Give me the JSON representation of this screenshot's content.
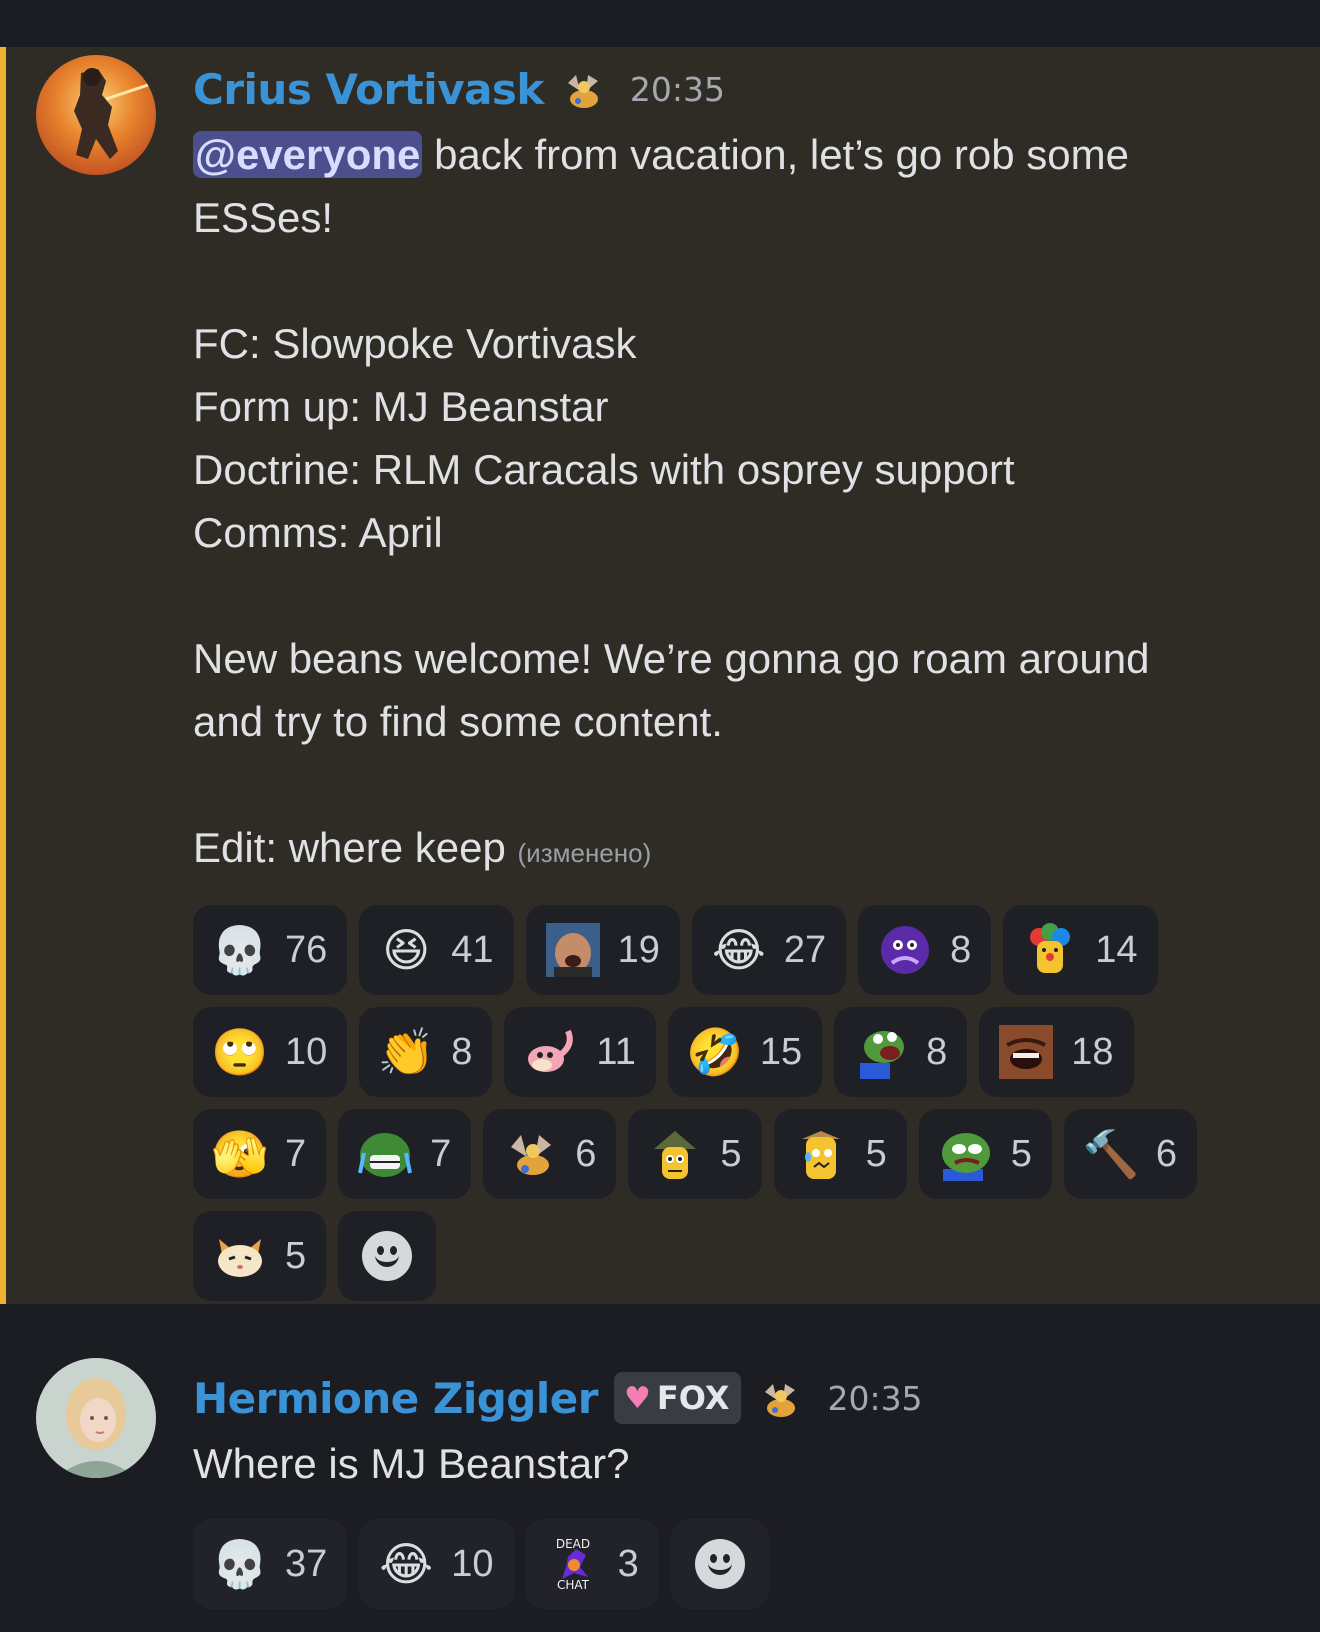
{
  "colors": {
    "author": "#3a93d6",
    "highlight_bg": "#2f2c26",
    "highlight_border": "#f0b232",
    "mention_bg": "#4c4f8e",
    "background": "#1c1d22"
  },
  "messages": [
    {
      "author": "Crius Vortivask",
      "role_icon": "winged-figure-icon",
      "timestamp": "20:35",
      "mention": "@everyone",
      "lines": [
        " back from vacation, let’s go rob some\nESSes!\n\nFC: Slowpoke Vortivask\nForm up: MJ Beanstar\nDoctrine: RLM Caracals with osprey support\nComms: April\n\nNew beans welcome! We’re gonna go roam around\nand try to find some content.\n\nEdit: where keep "
      ],
      "edited": "(изменено)",
      "reactions": [
        {
          "icon": "skull-emoji",
          "glyph": "💀",
          "count": "76"
        },
        {
          "icon": "laughing-squint-emoji",
          "glyph": "😆",
          "count": "41"
        },
        {
          "icon": "laughing-man-custom-emoji",
          "glyph": "",
          "count": "19"
        },
        {
          "icon": "tears-of-joy-emoji",
          "glyph": "😂",
          "count": "27"
        },
        {
          "icon": "purple-galaxy-custom-emoji",
          "glyph": "",
          "count": "8"
        },
        {
          "icon": "clown-bean-custom-emoji",
          "glyph": "",
          "count": "14"
        },
        {
          "icon": "eye-roll-emoji",
          "glyph": "🙄",
          "count": "10"
        },
        {
          "icon": "clapping-hands-emoji",
          "glyph": "👏",
          "count": "8"
        },
        {
          "icon": "slowpoke-custom-emoji",
          "glyph": "",
          "count": "11"
        },
        {
          "icon": "rofl-emoji",
          "glyph": "🤣",
          "count": "15"
        },
        {
          "icon": "pepe-shout-custom-emoji",
          "glyph": "",
          "count": "8"
        },
        {
          "icon": "laughing-face-custom-emoji",
          "glyph": "",
          "count": "18"
        },
        {
          "icon": "face-covering-hands-emoji",
          "glyph": "🫣",
          "count": "7"
        },
        {
          "icon": "pepe-crying-laugh-custom-emoji",
          "glyph": "",
          "count": "7"
        },
        {
          "icon": "winged-figure-custom-emoji",
          "glyph": "",
          "count": "6"
        },
        {
          "icon": "bean-hat-custom-emoji",
          "glyph": "",
          "count": "5"
        },
        {
          "icon": "bean-nervous-custom-emoji",
          "glyph": "",
          "count": "5"
        },
        {
          "icon": "pepe-sad-custom-emoji",
          "glyph": "",
          "count": "5"
        },
        {
          "icon": "hammer-emoji",
          "glyph": "🔨",
          "count": "6"
        },
        {
          "icon": "crying-cat-custom-emoji",
          "glyph": "",
          "count": "5"
        }
      ]
    },
    {
      "author": "Hermione Ziggler",
      "tag": "FOX",
      "tag_icon": "pink-heart-icon",
      "role_icon": "winged-figure-icon",
      "timestamp": "20:35",
      "text": "Where is MJ Beanstar?",
      "reactions": [
        {
          "icon": "skull-emoji",
          "glyph": "💀",
          "count": "37"
        },
        {
          "icon": "tears-of-joy-emoji",
          "glyph": "😂",
          "count": "10"
        },
        {
          "icon": "dead-chat-custom-emoji",
          "glyph": "",
          "count": "3",
          "label_top": "DEAD",
          "label_bottom": "CHAT"
        }
      ]
    }
  ]
}
